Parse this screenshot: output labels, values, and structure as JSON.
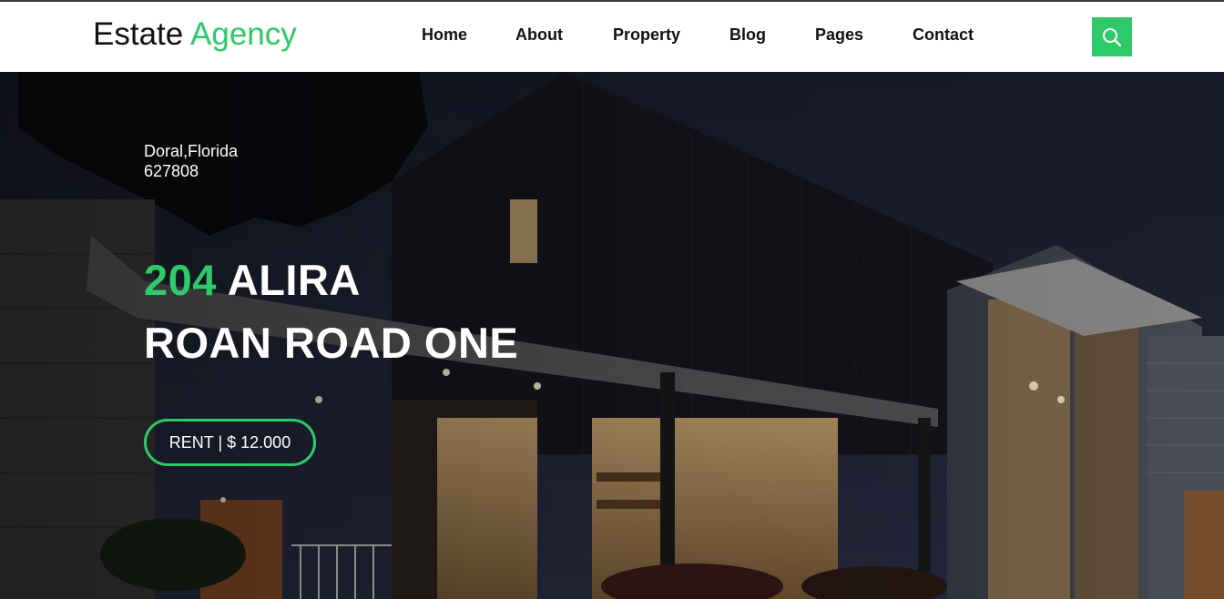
{
  "brand": {
    "name": "Estate",
    "accent": "Agency",
    "accent_color": "#2eca6a"
  },
  "nav": {
    "items": [
      "Home",
      "About",
      "Property",
      "Blog",
      "Pages",
      "Contact"
    ]
  },
  "search": {
    "icon": "search-icon"
  },
  "hero": {
    "location_line1": "Doral,Florida",
    "location_line2": "627808",
    "title_number": "204",
    "title_rest": "ALIRA",
    "title_line2": "ROAN ROAD ONE",
    "cta_label": "RENT | $ 12.000"
  }
}
